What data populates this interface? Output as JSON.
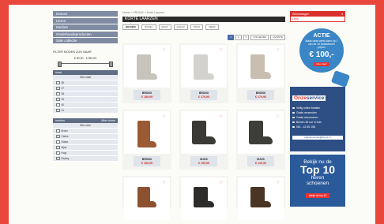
{
  "nav": {
    "items": [
      "Dames",
      "Heren",
      "Merken",
      "Onderhoudsproducten",
      "Sale collectie"
    ]
  },
  "filters": {
    "price_title": "FILTER MODEN ZIJN NAAR",
    "price_range": "€ 80,00 - € 350,00",
    "size_panel": {
      "title": "maat",
      "header_row": "Kies maat",
      "options": [
        "36",
        "37",
        "38",
        "39",
        "40",
        "41"
      ]
    },
    "brand_panel": {
      "title": "merken",
      "link": "Alles tonen",
      "header_row": "Kies merk",
      "options": [
        "Bronx",
        "Clarks",
        "Gabor",
        "Mjus",
        "Hogl",
        "Replay"
      ]
    }
  },
  "main": {
    "breadcrumb": "Home > VROUW > Korte Laarzen",
    "title": "KORTE LAARZEN",
    "tabs": [
      "BRANDS",
      "MODEL",
      "MAAT",
      "KLEUR",
      "PRIJS",
      "MERK"
    ],
    "pager": {
      "pages": [
        "1",
        "2",
        "3"
      ],
      "current": "1",
      "next": "VOLGENDE",
      "last": "LAATSTE"
    }
  },
  "products": [
    {
      "brand": "BRONX",
      "price": "€ 189,95",
      "color": "#c8c4bc"
    },
    {
      "brand": "BRONX",
      "price": "€ 179,95",
      "color": "#d4d2ce"
    },
    {
      "brand": "BRONX",
      "price": "€ 179,95",
      "color": "#c9bfb1"
    },
    {
      "brand": "BRONX",
      "price": "€ 189,95",
      "color": "#9a5a33"
    },
    {
      "brand": "MJUS",
      "price": "€ 159,95",
      "color": "#3b3a37"
    },
    {
      "brand": "MJUS",
      "price": "€ 149,95",
      "color": "#3d3d3a"
    },
    {
      "brand": "",
      "price": "",
      "color": "#8c5230"
    },
    {
      "brand": "",
      "price": "",
      "color": "#2e2c2a"
    },
    {
      "brand": "",
      "price": "",
      "color": "#4a3424"
    }
  ],
  "cart": {
    "title": "Winkelwagen",
    "status": "Leeg"
  },
  "promo": {
    "title": "ACTIE",
    "text": "Maak deze week kans op 1 van de 10 fantastische prijzen",
    "amount": "€ 100,-",
    "button": "Doe mee!"
  },
  "service": {
    "title_part1": "Onze",
    "title_part2": "service",
    "items": [
      "Veilig online betalen",
      "Gratis verzenden",
      "Gratis retourneren",
      "Binnen 48 uur in huis",
      "061 - 42 65 158"
    ],
    "email": "klantenservice@bronx.nl"
  },
  "top10": {
    "line1": "Bekijk nu de",
    "line2": "Top 10",
    "line3": "heren",
    "line4": "schoenen",
    "button": "bekijk de top 10"
  },
  "colors": {
    "page_border": "#e9463c",
    "nav_bg": "#7f8aa3",
    "price": "#d52b1e",
    "service_bg": "#2e4f84",
    "promo_blue": "#3a86c6"
  }
}
